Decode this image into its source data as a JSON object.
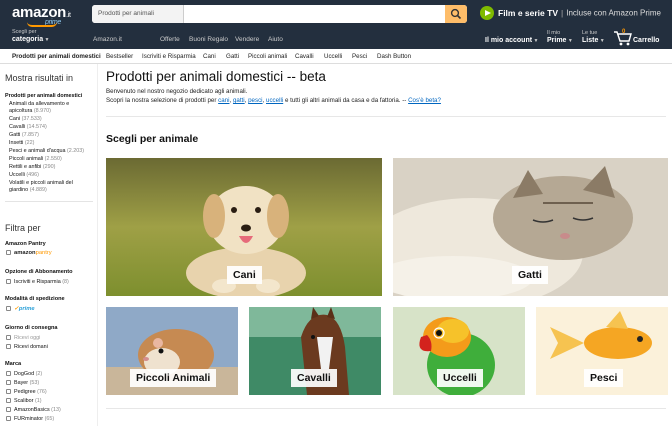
{
  "header": {
    "logo_text": "amazon",
    "logo_tld": ".it",
    "logo_sub": "prime",
    "search_dept": "Prodotti per animali domestici",
    "prime_video_title": "Film e serie TV",
    "prime_video_sub": "Incluse con Amazon Prime"
  },
  "nav": {
    "categories_small": "Scegli per",
    "categories_big": "categoria",
    "links": [
      "Amazon.it",
      "Offerte",
      "Buoni Regalo",
      "Vendere",
      "Aiuto"
    ],
    "account_label": "Il mio account",
    "my_prime_small": "Il mio",
    "my_prime_big": "Prime",
    "lists_small": "Le tue",
    "lists_big": "Liste",
    "cart_label": "Carrello",
    "cart_count": "0"
  },
  "subnav": {
    "items": [
      "Prodotti per animali domestici",
      "Bestseller",
      "Iscriviti e Risparmia",
      "Cani",
      "Gatti",
      "Piccoli animali",
      "Cavalli",
      "Uccelli",
      "Pesci",
      "Dash Button"
    ]
  },
  "sidebar": {
    "title": "Mostra risultati in",
    "root": "Prodotti per animali domestici",
    "categories": [
      {
        "label": "Animali da allevamento e",
        "count": ""
      },
      {
        "label": "apicoltura",
        "count": "(8.970)"
      },
      {
        "label": "Cani",
        "count": "(37.533)"
      },
      {
        "label": "Cavalli",
        "count": "(14.574)"
      },
      {
        "label": "Gatti",
        "count": "(7.857)"
      },
      {
        "label": "Insetti",
        "count": "(22)"
      },
      {
        "label": "Pesci e animali d'acqua",
        "count": "(2.203)"
      },
      {
        "label": "Piccoli animali",
        "count": "(2.550)"
      },
      {
        "label": "Rettili e anfibi",
        "count": "(290)"
      },
      {
        "label": "Uccelli",
        "count": "(496)"
      },
      {
        "label": "Volatili e piccoli animali del",
        "count": ""
      },
      {
        "label": "giardino",
        "count": "(4.889)"
      }
    ],
    "filter_title": "Filtra per",
    "pantry_head": "Amazon Pantry",
    "pantry_logo_a": "amazon",
    "pantry_logo_b": "pantry",
    "subscription_head": "Opzione di Abbonamento",
    "subscription_item": "Iscriviti e Risparmia",
    "subscription_count": "(8)",
    "shipping_head": "Modalità di spedizione",
    "prime_logo": "prime",
    "delivery_head": "Giorno di consegna",
    "delivery_items": [
      "Ricevi oggi",
      "Ricevi domani"
    ],
    "brand_head": "Marca",
    "brands": [
      {
        "label": "DogGod",
        "count": "(2)"
      },
      {
        "label": "Bayer",
        "count": "(53)"
      },
      {
        "label": "Pedigree",
        "count": "(76)"
      },
      {
        "label": "Scalibor",
        "count": "(1)"
      },
      {
        "label": "AmazonBasics",
        "count": "(13)"
      },
      {
        "label": "FURminator",
        "count": "(65)"
      }
    ]
  },
  "main": {
    "title": "Prodotti per animali domestici -- beta",
    "intro_line1": "Benvenuto nel nostro negozio dedicato agli animali.",
    "intro_line2_prefix": "Scopri la nostra selezione di prodotti per",
    "intro_links": [
      "cani",
      "gatti",
      "pesci",
      "uccelli"
    ],
    "intro_line2_suffix": "e tutti gli altri animali da casa e da fattoria. --",
    "beta_link": "Cos'è beta?",
    "section_title": "Scegli per animale",
    "tiles": [
      "Cani",
      "Gatti",
      "Piccoli Animali",
      "Cavalli",
      "Uccelli",
      "Pesci"
    ]
  },
  "colors": {
    "header_bg": "#232f3e",
    "search_button": "#febd69",
    "link": "#0066c0",
    "prime_video": "#7fba00",
    "accent": "#ff9900"
  }
}
